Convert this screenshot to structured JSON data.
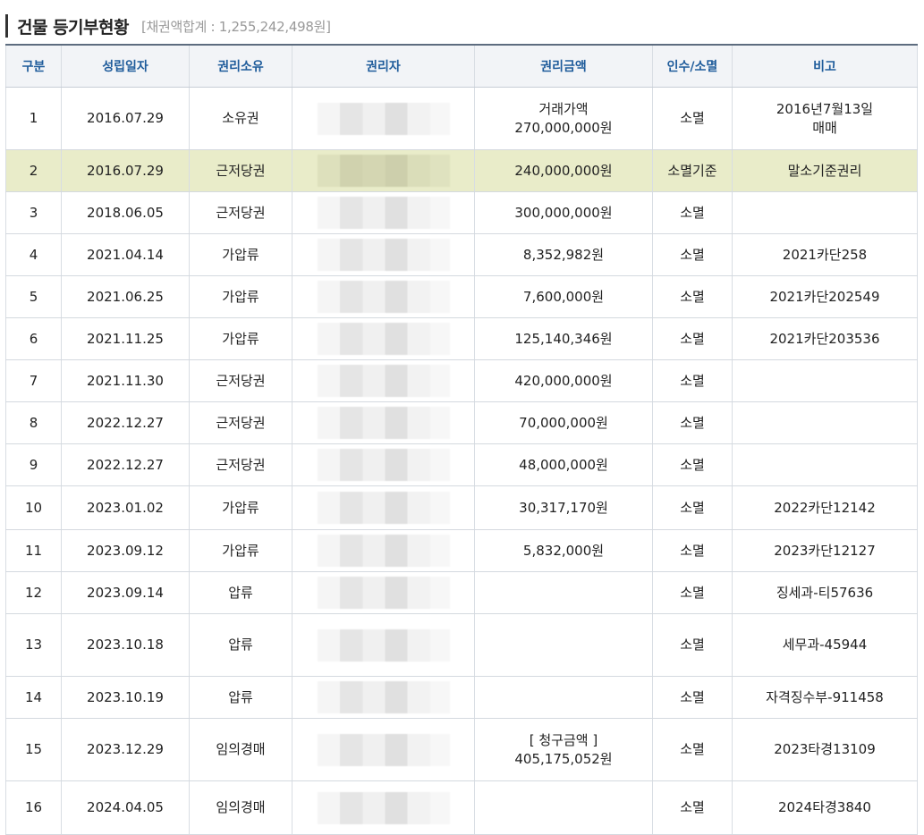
{
  "header": {
    "title": "건물 등기부현황",
    "subtitle": "[채권액합계 : 1,255,242,498원]"
  },
  "columns": [
    "구분",
    "성립일자",
    "권리소유",
    "권리자",
    "권리금액",
    "인수/소멸",
    "비고"
  ],
  "rows": [
    {
      "no": "1",
      "date": "2016.07.29",
      "type": "소유권",
      "amount": "거래가액",
      "amount2": "270,000,000원",
      "status": "소멸",
      "note": "2016년7월13일",
      "note2": "매매",
      "h": 70
    },
    {
      "no": "2",
      "date": "2016.07.29",
      "type": "근저당권",
      "amount": "240,000,000원",
      "amount2": "",
      "status": "소멸기준",
      "note": "말소기준권리",
      "note2": "",
      "h": 47,
      "highlight": true
    },
    {
      "no": "3",
      "date": "2018.06.05",
      "type": "근저당권",
      "amount": "300,000,000원",
      "amount2": "",
      "status": "소멸",
      "note": "",
      "note2": "",
      "h": 47
    },
    {
      "no": "4",
      "date": "2021.04.14",
      "type": "가압류",
      "amount": "8,352,982원",
      "amount2": "",
      "status": "소멸",
      "note": "2021카단258",
      "note2": "",
      "h": 47
    },
    {
      "no": "5",
      "date": "2021.06.25",
      "type": "가압류",
      "amount": "7,600,000원",
      "amount2": "",
      "status": "소멸",
      "note": "2021카단202549",
      "note2": "",
      "h": 47
    },
    {
      "no": "6",
      "date": "2021.11.25",
      "type": "가압류",
      "amount": "125,140,346원",
      "amount2": "",
      "status": "소멸",
      "note": "2021카단203536",
      "note2": "",
      "h": 47
    },
    {
      "no": "7",
      "date": "2021.11.30",
      "type": "근저당권",
      "amount": "420,000,000원",
      "amount2": "",
      "status": "소멸",
      "note": "",
      "note2": "",
      "h": 47
    },
    {
      "no": "8",
      "date": "2022.12.27",
      "type": "근저당권",
      "amount": "70,000,000원",
      "amount2": "",
      "status": "소멸",
      "note": "",
      "note2": "",
      "h": 47
    },
    {
      "no": "9",
      "date": "2022.12.27",
      "type": "근저당권",
      "amount": "48,000,000원",
      "amount2": "",
      "status": "소멸",
      "note": "",
      "note2": "",
      "h": 47
    },
    {
      "no": "10",
      "date": "2023.01.02",
      "type": "가압류",
      "amount": "30,317,170원",
      "amount2": "",
      "status": "소멸",
      "note": "2022카단12142",
      "note2": "",
      "h": 49
    },
    {
      "no": "11",
      "date": "2023.09.12",
      "type": "가압류",
      "amount": "5,832,000원",
      "amount2": "",
      "status": "소멸",
      "note": "2023카단12127",
      "note2": "",
      "h": 47
    },
    {
      "no": "12",
      "date": "2023.09.14",
      "type": "압류",
      "amount": "",
      "amount2": "",
      "status": "소멸",
      "note": "징세과-티57636",
      "note2": "",
      "h": 47
    },
    {
      "no": "13",
      "date": "2023.10.18",
      "type": "압류",
      "amount": "",
      "amount2": "",
      "status": "소멸",
      "note": "세무과-45944",
      "note2": "",
      "h": 70
    },
    {
      "no": "14",
      "date": "2023.10.19",
      "type": "압류",
      "amount": "",
      "amount2": "",
      "status": "소멸",
      "note": "자격징수부-911458",
      "note2": "",
      "h": 47
    },
    {
      "no": "15",
      "date": "2023.12.29",
      "type": "임의경매",
      "amount": "[ 청구금액 ]",
      "amount2": "405,175,052원",
      "status": "소멸",
      "note": "2023타경13109",
      "note2": "",
      "h": 70
    },
    {
      "no": "16",
      "date": "2024.04.05",
      "type": "임의경매",
      "amount": "",
      "amount2": "",
      "status": "소멸",
      "note": "2024타경3840",
      "note2": "",
      "h": 60
    }
  ]
}
